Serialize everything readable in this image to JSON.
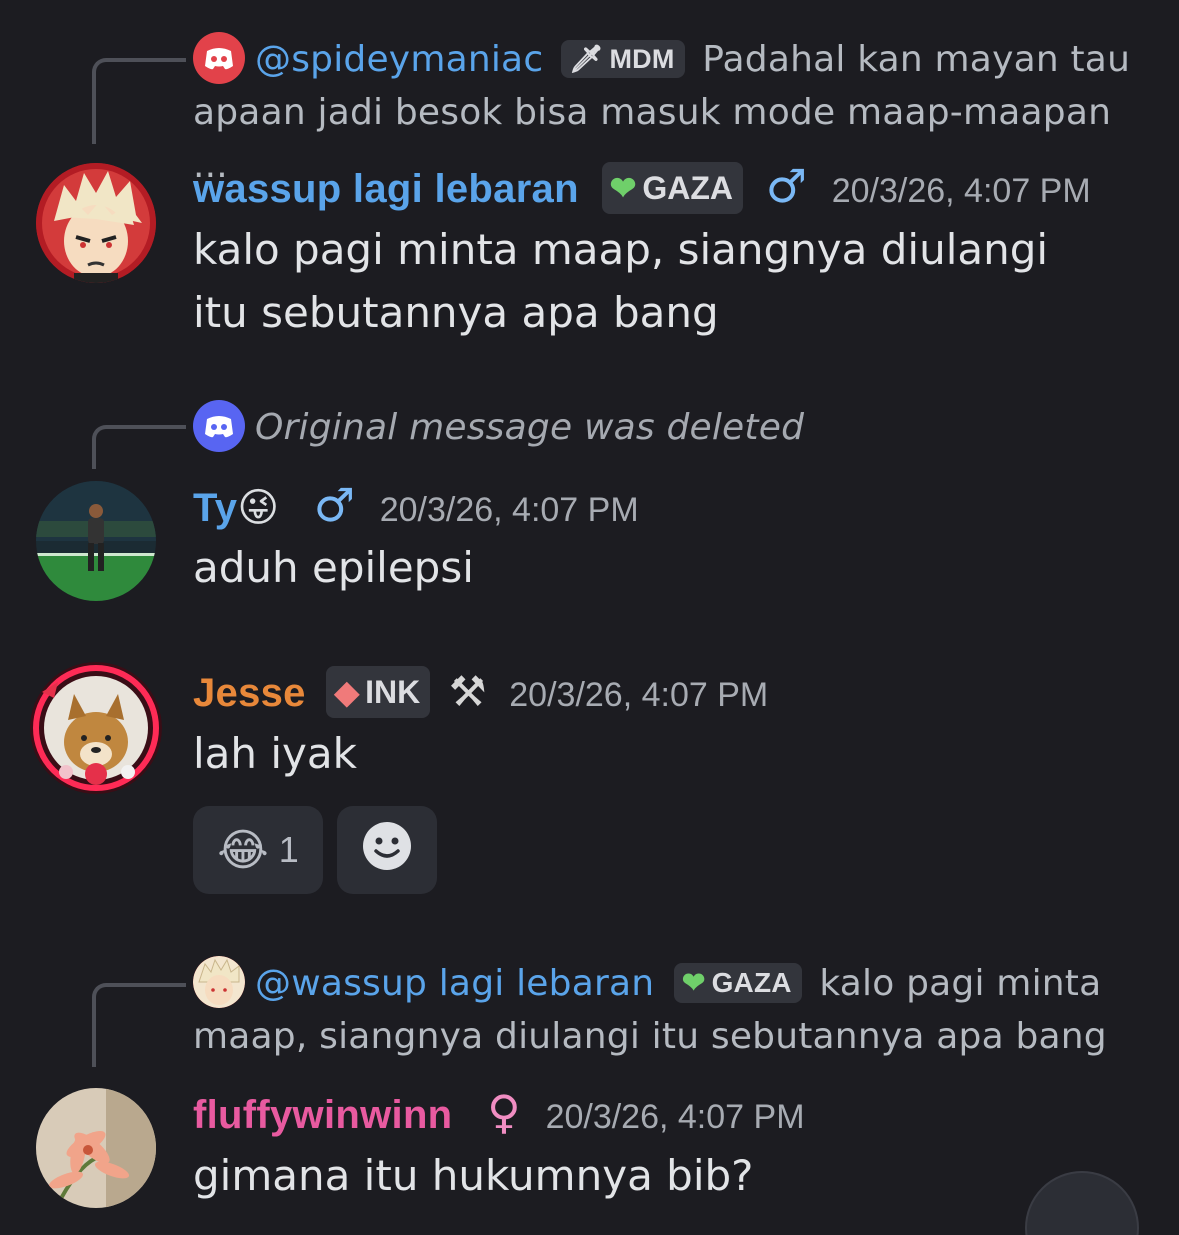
{
  "messages": [
    {
      "reply": {
        "author": "@spideymaniac",
        "badge": "MDM",
        "badge_icon": "sword-icon",
        "text": "Padahal kan mayan tau apaan jadi besok bisa masuk mode maap-maapan ..."
      },
      "author": "wassup lagi lebaran",
      "author_color": "#5aa4ea",
      "badge": "GAZA",
      "badge_icon": "green-heart-icon",
      "gender": "♂",
      "timestamp": "20/3/26, 4:07 PM",
      "content": "kalo pagi minta maap, siangnya diulangi itu sebutannya apa bang"
    },
    {
      "reply": {
        "text": "Original message was deleted"
      },
      "author": "Ty",
      "author_emoji": "😜",
      "author_color": "#5aa4ea",
      "gender": "♂",
      "timestamp": "20/3/26, 4:07 PM",
      "content": "aduh epilepsi"
    },
    {
      "author": "Jesse",
      "author_color": "#e8883a",
      "badge": "INK",
      "badge_icon": "red-gem-icon",
      "role_emoji": "⚒",
      "timestamp": "20/3/26, 4:07 PM",
      "content": "lah iyak",
      "reactions": [
        {
          "emoji": "😂",
          "count": "1"
        }
      ]
    },
    {
      "reply": {
        "author": "@wassup lagi lebaran",
        "badge": "GAZA",
        "badge_icon": "green-heart-icon",
        "text": "kalo pagi minta maap, siangnya diulangi itu sebutannya apa bang"
      },
      "author": "fluffywinwinn",
      "author_color": "#e85aa0",
      "gender": "♀",
      "timestamp": "20/3/26, 4:07 PM",
      "content": "gimana itu hukumnya bib?"
    }
  ],
  "colors": {
    "background": "#1c1c21",
    "mention": "#5aa4ea",
    "male_symbol": "#7ab8f5",
    "female_symbol": "#f08dc2"
  }
}
